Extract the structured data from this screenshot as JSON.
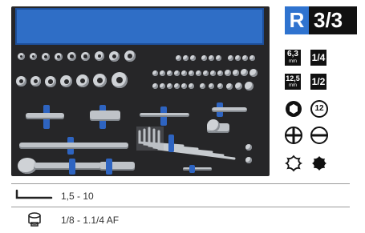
{
  "badge": {
    "letter": "R",
    "fraction": "3/3"
  },
  "icons": {
    "drive_63": "6,3",
    "drive_63_unit": "mm",
    "drive_frac_14": "1/4",
    "drive_125": "12,5",
    "drive_125_unit": "mm",
    "drive_frac_12": "1/2",
    "bit_count": "12"
  },
  "legend": [
    {
      "icon": "hex-key-icon",
      "text": "1,5 - 10"
    },
    {
      "icon": "socket-icon",
      "text": "1/8 - 1.1/4 AF"
    }
  ],
  "colors": {
    "tray": "#262628",
    "label": "#2f6ec6",
    "accent": "#2f73cf"
  }
}
